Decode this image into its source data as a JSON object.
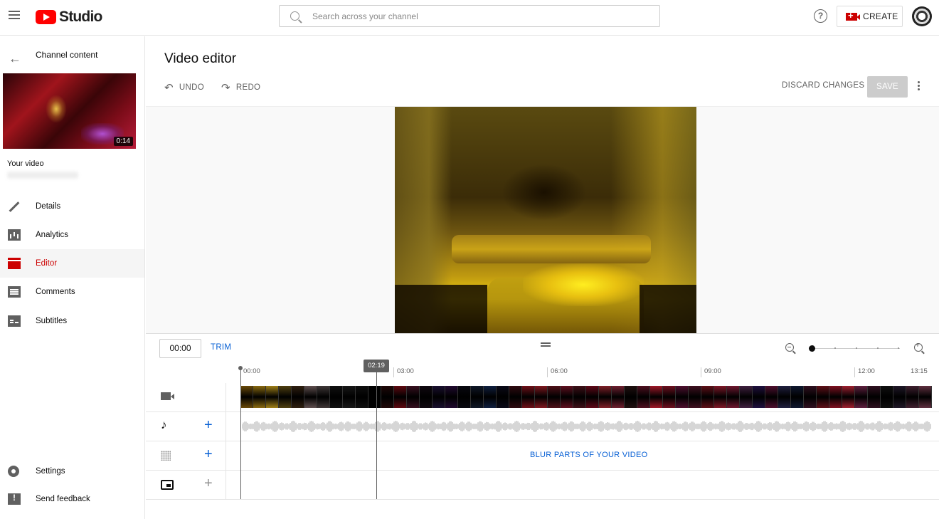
{
  "app": {
    "brand": "Studio"
  },
  "search": {
    "placeholder": "Search across your channel"
  },
  "header": {
    "create_label": "CREATE",
    "help_glyph": "?"
  },
  "sidebar": {
    "back_label": "Channel content",
    "video_duration": "0:14",
    "your_video_label": "Your video",
    "items": [
      {
        "label": "Details",
        "icon": "pencil-icon",
        "active": false
      },
      {
        "label": "Analytics",
        "icon": "analytics-icon",
        "active": false
      },
      {
        "label": "Editor",
        "icon": "editor-icon",
        "active": true
      },
      {
        "label": "Comments",
        "icon": "comments-icon",
        "active": false
      },
      {
        "label": "Subtitles",
        "icon": "subtitles-icon",
        "active": false
      }
    ],
    "bottom_items": [
      {
        "label": "Settings",
        "icon": "gear-icon"
      },
      {
        "label": "Send feedback",
        "icon": "feedback-icon"
      }
    ]
  },
  "editor": {
    "title": "Video editor",
    "undo_label": "UNDO",
    "redo_label": "REDO",
    "discard_label": "DISCARD CHANGES",
    "save_label": "SAVE"
  },
  "timeline": {
    "current_time": "00:00",
    "trim_label": "TRIM",
    "playhead_time": "02:19",
    "ticks": [
      "00:00",
      "03:00",
      "06:00",
      "09:00",
      "12:00",
      "13:15"
    ],
    "blur_label": "BLUR PARTS OF YOUR VIDEO",
    "frame_colors": [
      "#6a4a08",
      "#8a6a10",
      "#a08018",
      "#504010",
      "#302010",
      "#605050",
      "#403838",
      "#101010",
      "#181818",
      "#101010",
      "#000000",
      "#200808",
      "#600810",
      "#381020",
      "#100810",
      "#1a1030",
      "#200a30",
      "#080810",
      "#101828",
      "#102040",
      "#0a0a18",
      "#300a10",
      "#701018",
      "#801820",
      "#501018",
      "#601020",
      "#401018",
      "#600818",
      "#802028",
      "#702030",
      "#201010",
      "#501020",
      "#a01828",
      "#701020",
      "#501030",
      "#401020",
      "#601018",
      "#801828",
      "#701830",
      "#402040",
      "#201040",
      "#501030",
      "#202040",
      "#101830",
      "#301020",
      "#601018",
      "#801020",
      "#a02030",
      "#602040",
      "#301020",
      "#101010",
      "#201828",
      "#402030",
      "#603040"
    ],
    "accent_blue": "#065fd4",
    "accent_red": "#cc0000"
  }
}
